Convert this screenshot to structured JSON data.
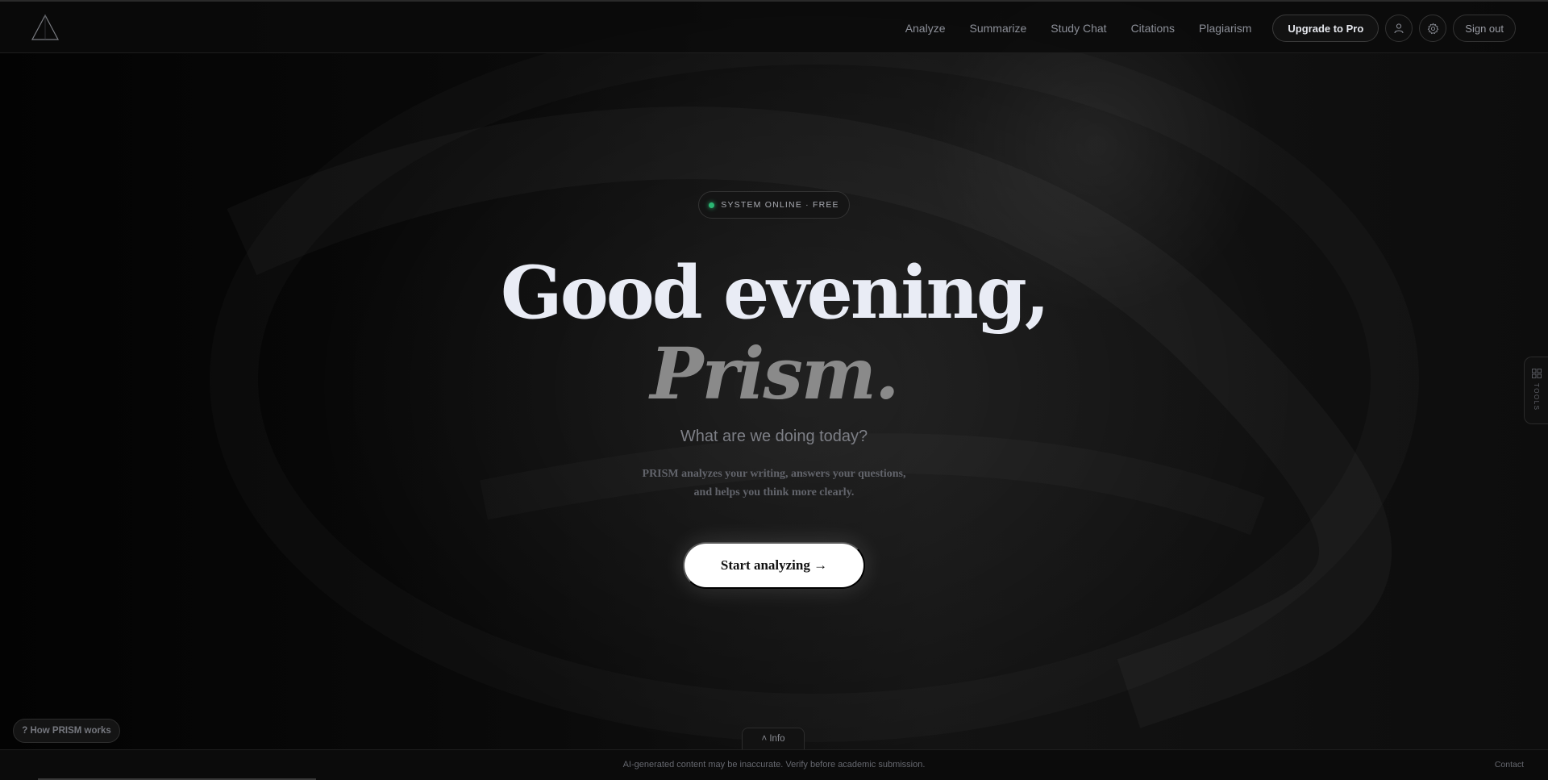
{
  "nav": {
    "links": [
      "Analyze",
      "Summarize",
      "Study Chat",
      "Citations",
      "Plagiarism"
    ],
    "upgrade_label": "Upgrade to Pro",
    "signout_label": "Sign out",
    "icons": [
      "user-icon",
      "gear-icon"
    ]
  },
  "hero": {
    "status": "SYSTEM ONLINE · FREE",
    "greeting": "Good evening,",
    "name": "Prism.",
    "question": "What are we doing today?",
    "description_line1": "PRISM analyzes your writing, answers your questions,",
    "description_line2": "and helps you think more clearly.",
    "cta_label": "Start analyzing →"
  },
  "side": {
    "tools_label": "TOOLS"
  },
  "bottom": {
    "how_label": "? How PRISM works",
    "info_label": "˄ Info",
    "footer_note": "AI-generated content may be inaccurate. Verify before academic submission.",
    "contact_label": "Contact"
  },
  "colors": {
    "status_dot": "#2bb673",
    "cta_background": "#ffffff",
    "accent_text": "#e9ecf5",
    "muted_text": "#8a8a8a"
  }
}
